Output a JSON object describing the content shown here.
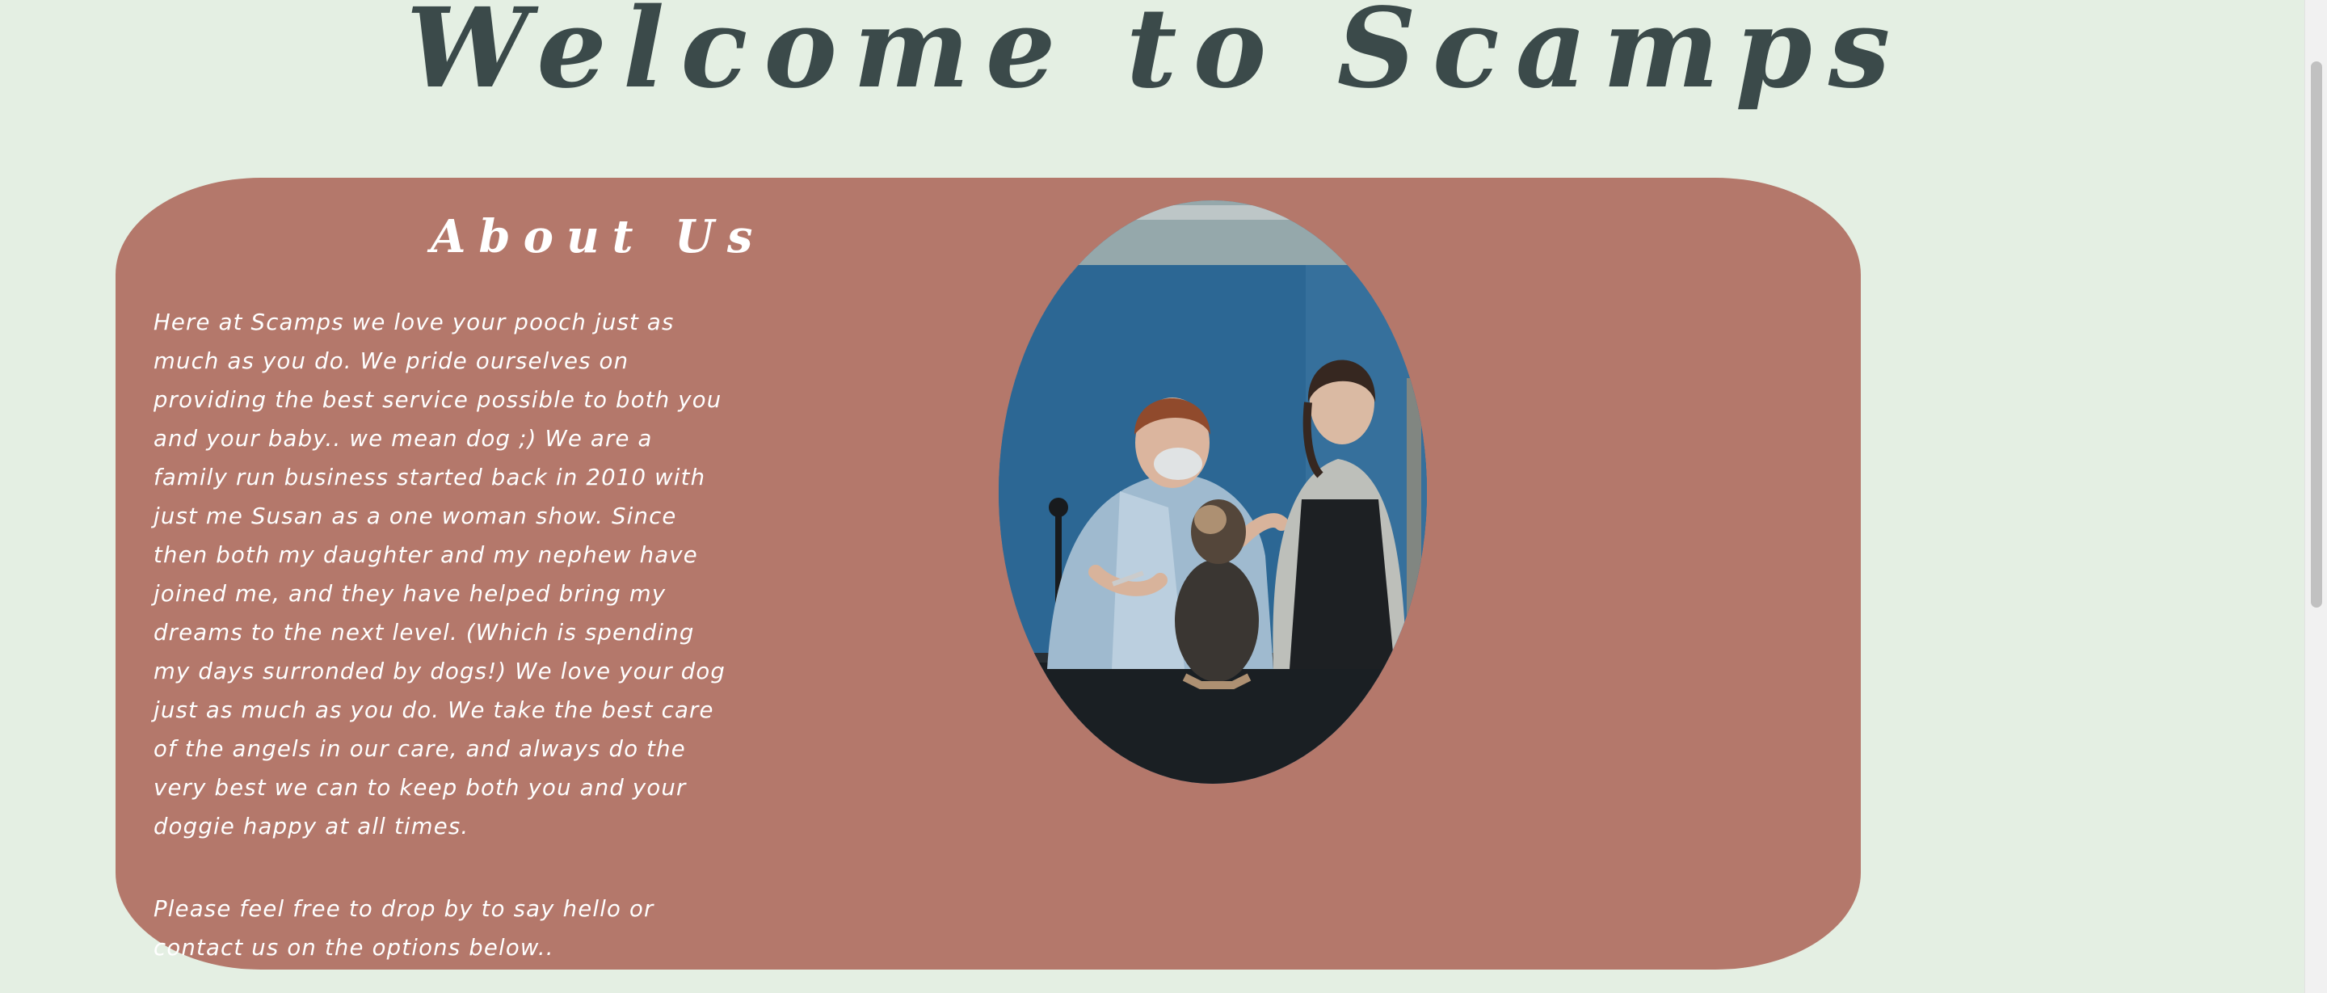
{
  "site": {
    "title": "Welcome to Scamps"
  },
  "about": {
    "heading": "About Us",
    "paragraphs": [
      "Here at Scamps we love your pooch just as much as you do. We pride ourselves on providing the best service possible to both you and your baby.. we mean dog ;) We are a family run business started back in 2010 with just me Susan as a one woman show. Since then both my daughter and my nephew have joined me, and they have helped bring my dreams to the next level. (Which is spending my days surronded by dogs!) We love your dog just as much as you do. We take the best care of the angels in our care, and always do the very best we can to keep both you and your doggie happy at all times.",
      "Please feel free to drop by to say hello or contact us on the options below.."
    ],
    "image": "photo of two groomers grooming a small dog on a grooming table"
  },
  "colors": {
    "background": "#e4efe3",
    "card": "#b4786b",
    "title": "#3b4a4a",
    "text": "#ffffff"
  }
}
